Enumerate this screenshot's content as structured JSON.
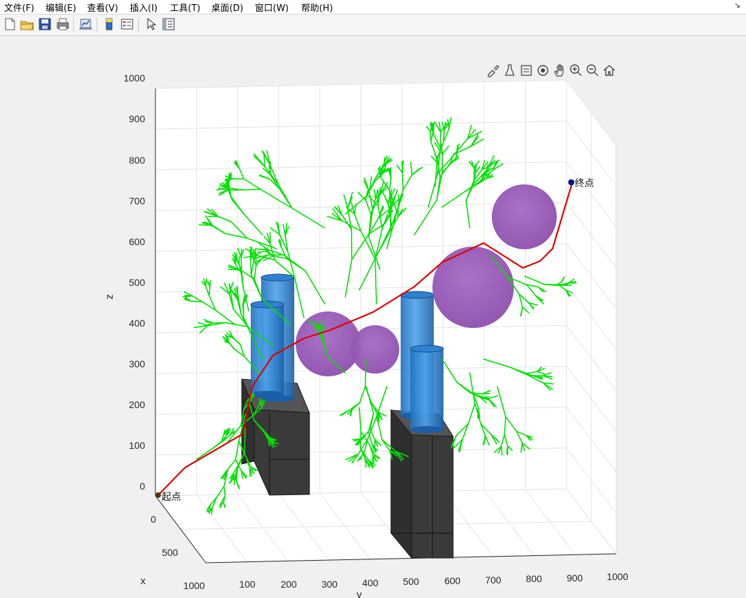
{
  "menu": [
    "文件(F)",
    "编辑(E)",
    "查看(V)",
    "插入(I)",
    "工具(T)",
    "桌面(D)",
    "窗口(W)",
    "帮助(H)"
  ],
  "toolbar_icons": [
    "new-figure-icon",
    "open-file-icon",
    "save-icon",
    "print-icon",
    "link-plot-icon",
    "colorbar-icon",
    "legend-icon",
    "select-pointer-icon",
    "property-inspector-icon"
  ],
  "axes_toolbar_icons": [
    "brush-icon",
    "data-tip-icon",
    "restore-view-icon",
    "rotate-3d-icon",
    "pan-hand-icon",
    "zoom-in-icon",
    "zoom-out-icon",
    "home-icon"
  ],
  "plot": {
    "zlabel": "z",
    "xlabel": "x",
    "ylabel": "y",
    "z_ticks": [
      "1000",
      "900",
      "800",
      "700",
      "600",
      "500",
      "400",
      "300",
      "200",
      "100",
      "0"
    ],
    "y_ticks": [
      "100",
      "200",
      "300",
      "400",
      "500",
      "600",
      "700",
      "800",
      "900",
      "1000"
    ],
    "x_ticks": [
      "0",
      "500",
      "1000"
    ],
    "start_label": "起点",
    "end_label": "终点"
  },
  "colors": {
    "tree": "#00e000",
    "path": "#e00000",
    "sphere": "#9b59b6",
    "cylinder": "#2e86d6",
    "box": "#3a3a3a",
    "endpoint": "#001a80"
  }
}
